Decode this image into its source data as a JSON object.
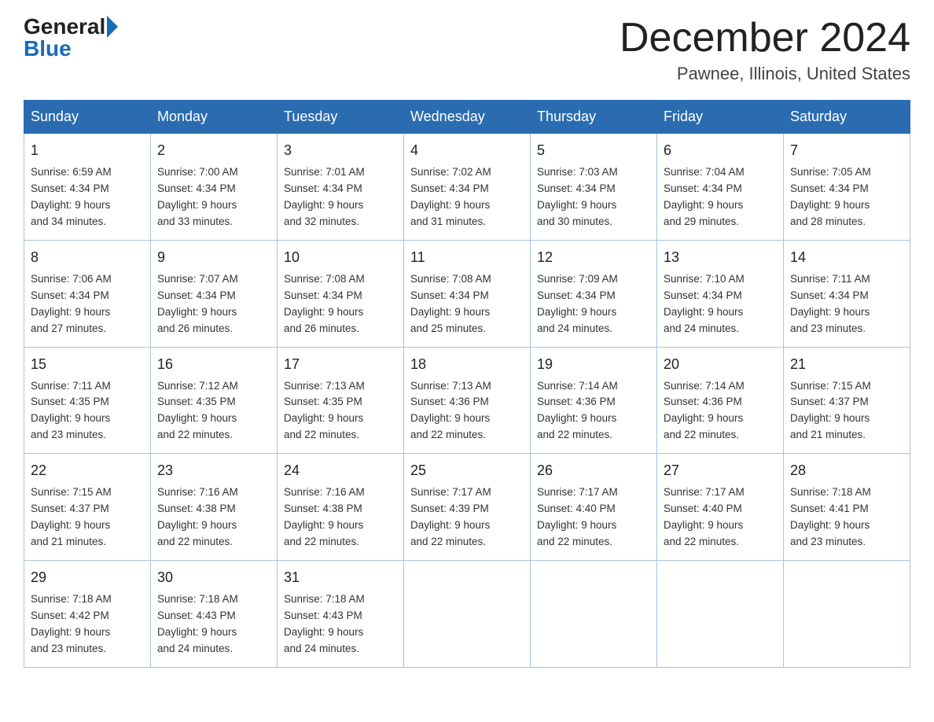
{
  "logo": {
    "general": "General",
    "blue": "Blue"
  },
  "title": "December 2024",
  "location": "Pawnee, Illinois, United States",
  "weekdays": [
    "Sunday",
    "Monday",
    "Tuesday",
    "Wednesday",
    "Thursday",
    "Friday",
    "Saturday"
  ],
  "weeks": [
    [
      {
        "day": "1",
        "sunrise": "6:59 AM",
        "sunset": "4:34 PM",
        "daylight": "9 hours and 34 minutes."
      },
      {
        "day": "2",
        "sunrise": "7:00 AM",
        "sunset": "4:34 PM",
        "daylight": "9 hours and 33 minutes."
      },
      {
        "day": "3",
        "sunrise": "7:01 AM",
        "sunset": "4:34 PM",
        "daylight": "9 hours and 32 minutes."
      },
      {
        "day": "4",
        "sunrise": "7:02 AM",
        "sunset": "4:34 PM",
        "daylight": "9 hours and 31 minutes."
      },
      {
        "day": "5",
        "sunrise": "7:03 AM",
        "sunset": "4:34 PM",
        "daylight": "9 hours and 30 minutes."
      },
      {
        "day": "6",
        "sunrise": "7:04 AM",
        "sunset": "4:34 PM",
        "daylight": "9 hours and 29 minutes."
      },
      {
        "day": "7",
        "sunrise": "7:05 AM",
        "sunset": "4:34 PM",
        "daylight": "9 hours and 28 minutes."
      }
    ],
    [
      {
        "day": "8",
        "sunrise": "7:06 AM",
        "sunset": "4:34 PM",
        "daylight": "9 hours and 27 minutes."
      },
      {
        "day": "9",
        "sunrise": "7:07 AM",
        "sunset": "4:34 PM",
        "daylight": "9 hours and 26 minutes."
      },
      {
        "day": "10",
        "sunrise": "7:08 AM",
        "sunset": "4:34 PM",
        "daylight": "9 hours and 26 minutes."
      },
      {
        "day": "11",
        "sunrise": "7:08 AM",
        "sunset": "4:34 PM",
        "daylight": "9 hours and 25 minutes."
      },
      {
        "day": "12",
        "sunrise": "7:09 AM",
        "sunset": "4:34 PM",
        "daylight": "9 hours and 24 minutes."
      },
      {
        "day": "13",
        "sunrise": "7:10 AM",
        "sunset": "4:34 PM",
        "daylight": "9 hours and 24 minutes."
      },
      {
        "day": "14",
        "sunrise": "7:11 AM",
        "sunset": "4:34 PM",
        "daylight": "9 hours and 23 minutes."
      }
    ],
    [
      {
        "day": "15",
        "sunrise": "7:11 AM",
        "sunset": "4:35 PM",
        "daylight": "9 hours and 23 minutes."
      },
      {
        "day": "16",
        "sunrise": "7:12 AM",
        "sunset": "4:35 PM",
        "daylight": "9 hours and 22 minutes."
      },
      {
        "day": "17",
        "sunrise": "7:13 AM",
        "sunset": "4:35 PM",
        "daylight": "9 hours and 22 minutes."
      },
      {
        "day": "18",
        "sunrise": "7:13 AM",
        "sunset": "4:36 PM",
        "daylight": "9 hours and 22 minutes."
      },
      {
        "day": "19",
        "sunrise": "7:14 AM",
        "sunset": "4:36 PM",
        "daylight": "9 hours and 22 minutes."
      },
      {
        "day": "20",
        "sunrise": "7:14 AM",
        "sunset": "4:36 PM",
        "daylight": "9 hours and 22 minutes."
      },
      {
        "day": "21",
        "sunrise": "7:15 AM",
        "sunset": "4:37 PM",
        "daylight": "9 hours and 21 minutes."
      }
    ],
    [
      {
        "day": "22",
        "sunrise": "7:15 AM",
        "sunset": "4:37 PM",
        "daylight": "9 hours and 21 minutes."
      },
      {
        "day": "23",
        "sunrise": "7:16 AM",
        "sunset": "4:38 PM",
        "daylight": "9 hours and 22 minutes."
      },
      {
        "day": "24",
        "sunrise": "7:16 AM",
        "sunset": "4:38 PM",
        "daylight": "9 hours and 22 minutes."
      },
      {
        "day": "25",
        "sunrise": "7:17 AM",
        "sunset": "4:39 PM",
        "daylight": "9 hours and 22 minutes."
      },
      {
        "day": "26",
        "sunrise": "7:17 AM",
        "sunset": "4:40 PM",
        "daylight": "9 hours and 22 minutes."
      },
      {
        "day": "27",
        "sunrise": "7:17 AM",
        "sunset": "4:40 PM",
        "daylight": "9 hours and 22 minutes."
      },
      {
        "day": "28",
        "sunrise": "7:18 AM",
        "sunset": "4:41 PM",
        "daylight": "9 hours and 23 minutes."
      }
    ],
    [
      {
        "day": "29",
        "sunrise": "7:18 AM",
        "sunset": "4:42 PM",
        "daylight": "9 hours and 23 minutes."
      },
      {
        "day": "30",
        "sunrise": "7:18 AM",
        "sunset": "4:43 PM",
        "daylight": "9 hours and 24 minutes."
      },
      {
        "day": "31",
        "sunrise": "7:18 AM",
        "sunset": "4:43 PM",
        "daylight": "9 hours and 24 minutes."
      },
      null,
      null,
      null,
      null
    ]
  ],
  "labels": {
    "sunrise": "Sunrise:",
    "sunset": "Sunset:",
    "daylight": "Daylight:"
  }
}
